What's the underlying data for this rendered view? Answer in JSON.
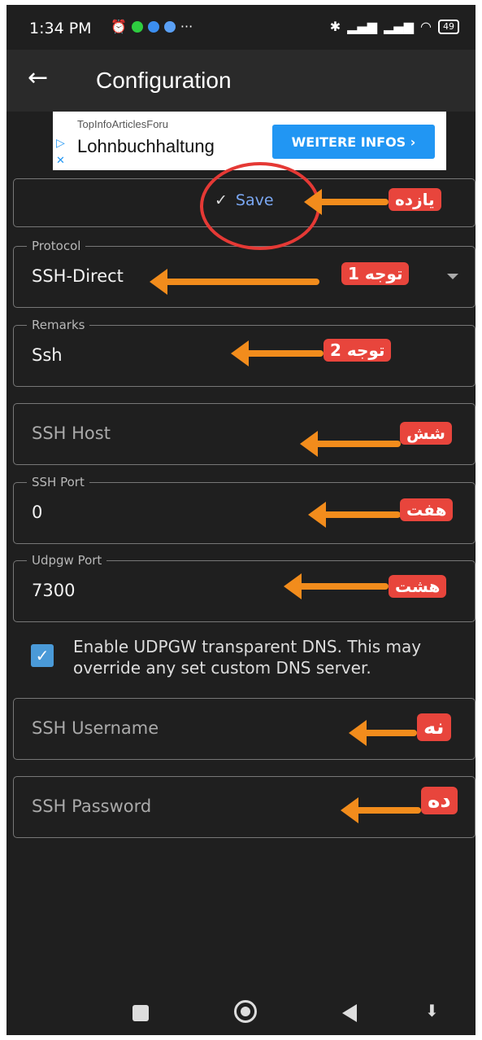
{
  "status_bar": {
    "time": "1:34 PM",
    "battery": "49"
  },
  "app_bar": {
    "title": "Configuration"
  },
  "ad": {
    "small_text": "TopInfoArticlesForu",
    "headline": "Lohnbuchhaltung",
    "button": "WEITERE INFOS ›"
  },
  "save_label": "Save",
  "fields": {
    "protocol": {
      "label": "Protocol",
      "value": "SSH-Direct"
    },
    "remarks": {
      "label": "Remarks",
      "value": "Ssh"
    },
    "ssh_host": {
      "placeholder": "SSH Host"
    },
    "ssh_port": {
      "label": "SSH Port",
      "value": "0"
    },
    "udpgw_port": {
      "label": "Udpgw Port",
      "value": "7300"
    },
    "ssh_username": {
      "placeholder": "SSH Username"
    },
    "ssh_password": {
      "placeholder": "SSH Password"
    }
  },
  "checkbox": {
    "checked": true,
    "label": "Enable UDPGW transparent DNS. This may override any set custom DNS server."
  },
  "annotations": {
    "save": "یازده",
    "protocol": "توجه 1",
    "remarks": "توجه 2",
    "host": "شش",
    "port": "هفت",
    "udpgw": "هشت",
    "username": "نه",
    "password": "ده"
  },
  "colors": {
    "background": "#1f1f1f",
    "accent": "#4a9ad8",
    "annotation_arrow": "#f28c1c",
    "annotation_tag": "#e8453c"
  }
}
